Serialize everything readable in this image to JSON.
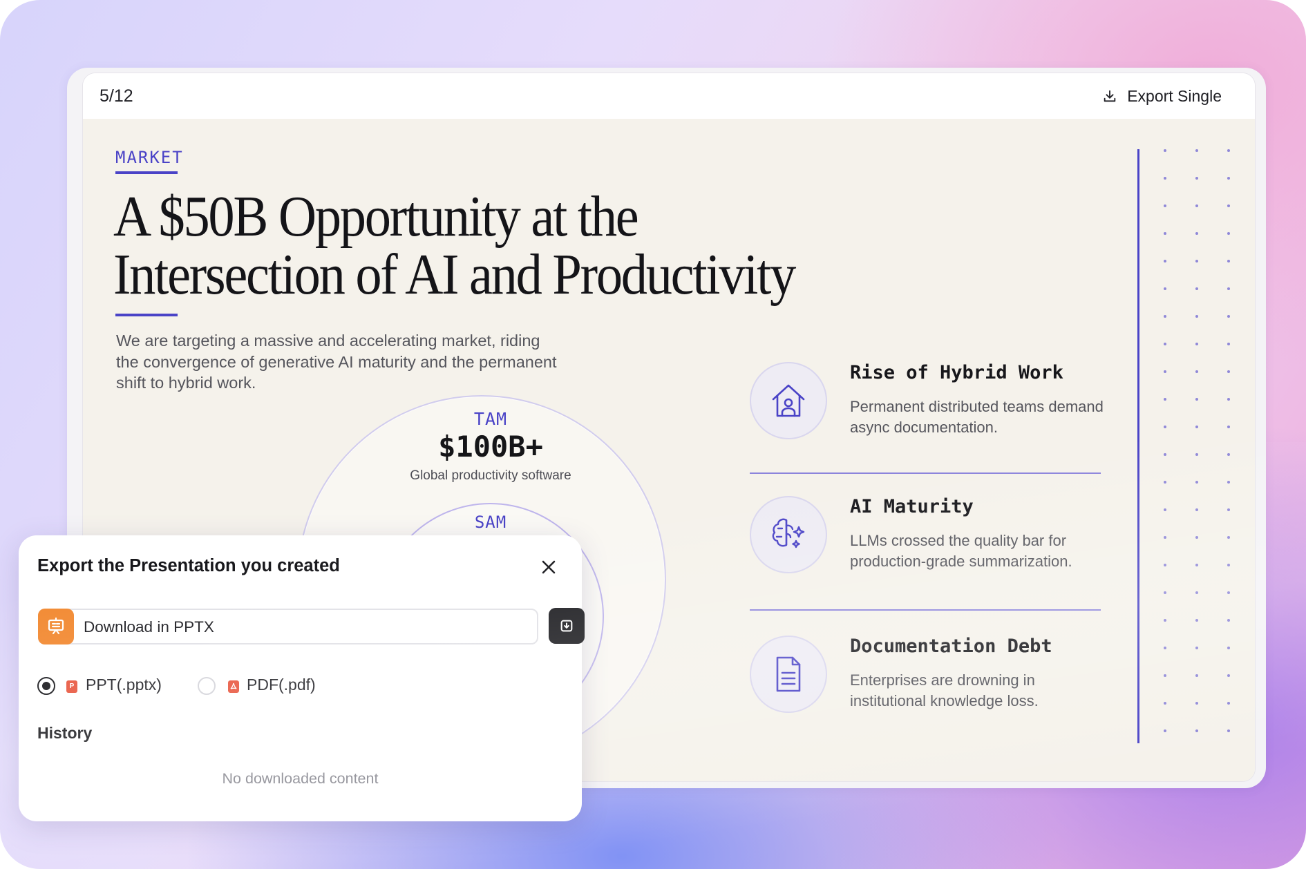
{
  "viewer": {
    "page_counter": "5/12",
    "export_single_label": "Export Single",
    "export_icon": "download-icon"
  },
  "slide": {
    "eyebrow": "MARKET",
    "title_line1": "A $50B Opportunity at the",
    "title_line2": "Intersection of AI and Productivity",
    "lede": "We are targeting a massive and accelerating market, riding the convergence of generative AI maturity and the permanent shift to hybrid work.",
    "tam": {
      "label": "TAM",
      "value": "$100B+",
      "desc": "Global productivity software"
    },
    "sam": {
      "label": "SAM"
    },
    "drivers": [
      {
        "title": "Rise of Hybrid Work",
        "desc": "Permanent distributed teams demand async documentation.",
        "icon": "home-user-icon"
      },
      {
        "title": "AI Maturity",
        "desc": "LLMs crossed the quality bar for production-grade summarization.",
        "icon": "brain-sparkle-icon"
      },
      {
        "title": "Documentation Debt",
        "desc": "Enterprises are drowning in institutional knowledge loss.",
        "icon": "document-icon"
      }
    ],
    "accent_color": "#4a43c7",
    "background_color": "#f5f2eb"
  },
  "dialog": {
    "title": "Export the Presentation you created",
    "download_label": "Download in PPTX",
    "formats": [
      {
        "label": "PPT(.pptx)",
        "selected": true,
        "icon_letter": "P",
        "icon_color": "#e8543c"
      },
      {
        "label": "PDF(.pdf)",
        "selected": false,
        "icon_color": "#e8543c"
      }
    ],
    "history_title": "History",
    "history_empty": "No downloaded content",
    "badge_color": "#f28a33"
  }
}
